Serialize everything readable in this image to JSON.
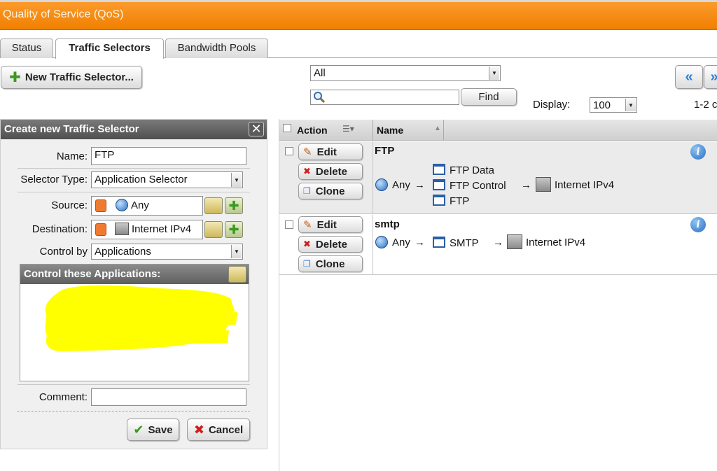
{
  "window": {
    "title": "Quality of Service (QoS)"
  },
  "tabs": [
    {
      "label": "Status"
    },
    {
      "label": "Traffic Selectors"
    },
    {
      "label": "Bandwidth Pools"
    }
  ],
  "toolbar": {
    "new_button_label": "New Traffic Selector...",
    "filter_value": "All",
    "search_placeholder": "",
    "find_label": "Find",
    "display_label": "Display:",
    "display_value": "100",
    "range_text": "1-2 c"
  },
  "form": {
    "title": "Create new Traffic Selector",
    "name_label": "Name:",
    "name_value": "FTP",
    "selector_type_label": "Selector Type:",
    "selector_type_value": "Application Selector",
    "source_label": "Source:",
    "source_value": "Any",
    "destination_label": "Destination:",
    "destination_value": "Internet IPv4",
    "control_by_label": "Control by",
    "control_by_value": "Applications",
    "apps_header": "Control these Applications:",
    "comment_label": "Comment:",
    "comment_value": "",
    "save_label": "Save",
    "cancel_label": "Cancel"
  },
  "table": {
    "col_action": "Action",
    "col_name": "Name",
    "action_labels": {
      "edit": "Edit",
      "delete": "Delete",
      "clone": "Clone"
    },
    "rows": [
      {
        "name": "FTP",
        "source": "Any",
        "services": [
          "FTP Data",
          "FTP Control",
          "FTP"
        ],
        "destination": "Internet IPv4"
      },
      {
        "name": "smtp",
        "source": "Any",
        "services": [
          "SMTP"
        ],
        "destination": "Internet IPv4"
      }
    ],
    "arrow": "→"
  },
  "colors": {
    "title_orange": "#f08000",
    "panel_header": "#5a5a5a",
    "redaction": "#ffff00",
    "info_blue": "#2a6fc0"
  }
}
